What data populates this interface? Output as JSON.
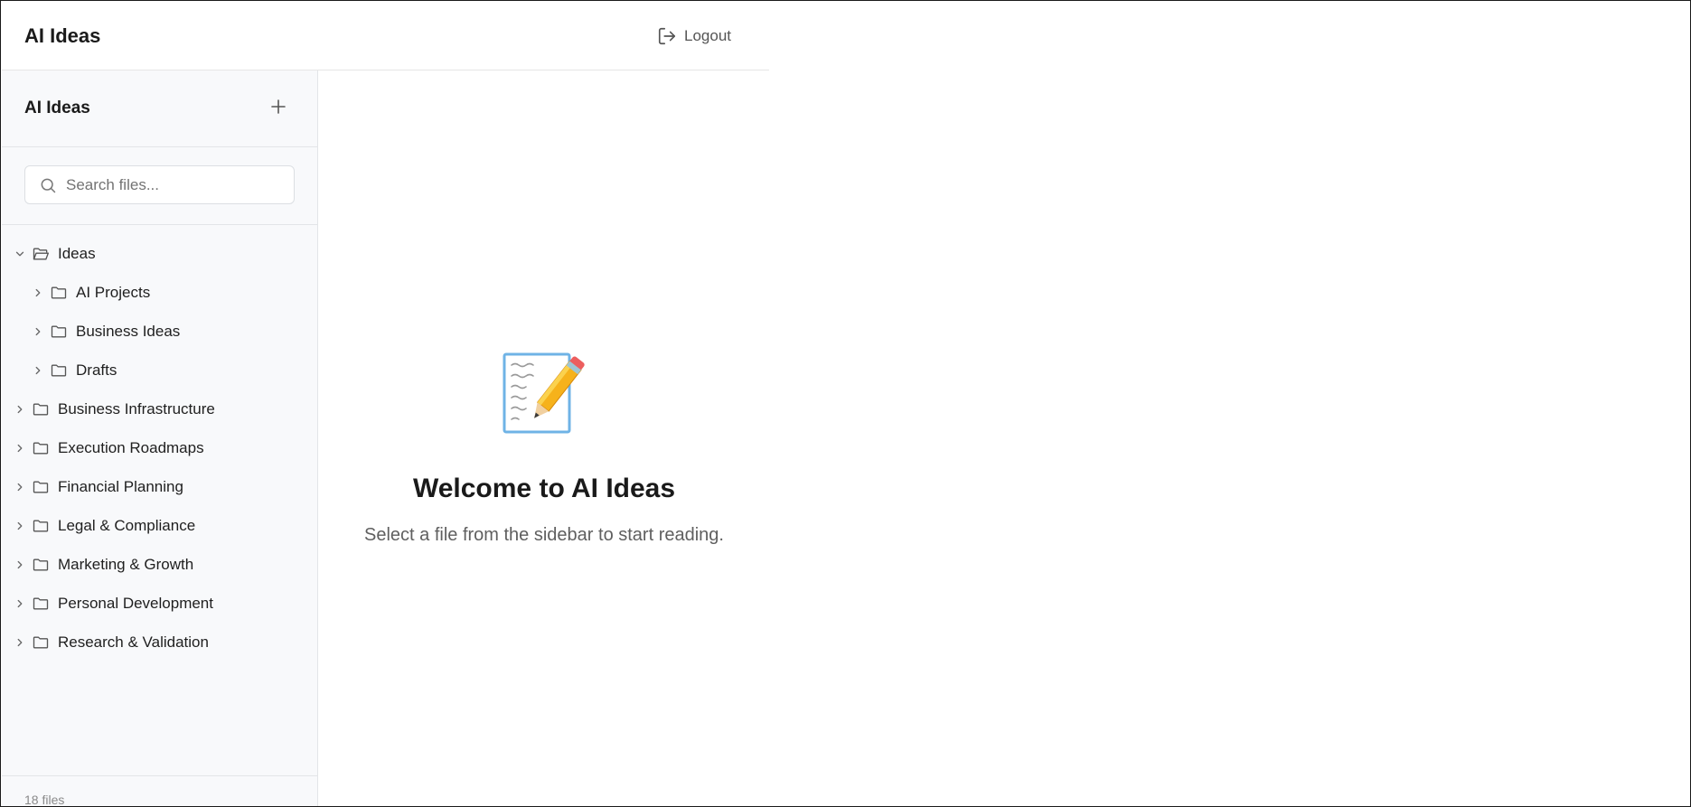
{
  "header": {
    "app_title": "AI Ideas",
    "logout_label": "Logout",
    "logout_icon": "logout-icon"
  },
  "sidebar": {
    "title": "AI Ideas",
    "add_icon": "plus-icon",
    "search": {
      "placeholder": "Search files...",
      "value": "",
      "icon": "search-icon"
    },
    "tree": [
      {
        "label": "Ideas",
        "expanded": true,
        "children": [
          {
            "label": "AI Projects",
            "expanded": false
          },
          {
            "label": "Business Ideas",
            "expanded": false
          },
          {
            "label": "Drafts",
            "expanded": false
          }
        ]
      },
      {
        "label": "Business Infrastructure",
        "expanded": false
      },
      {
        "label": "Execution Roadmaps",
        "expanded": false
      },
      {
        "label": "Financial Planning",
        "expanded": false
      },
      {
        "label": "Legal & Compliance",
        "expanded": false
      },
      {
        "label": "Marketing & Growth",
        "expanded": false
      },
      {
        "label": "Personal Development",
        "expanded": false
      },
      {
        "label": "Research & Validation",
        "expanded": false
      }
    ],
    "footer_count": "18 files"
  },
  "main": {
    "illustration": "memo-pencil-icon",
    "welcome_title": "Welcome to AI Ideas",
    "welcome_subtitle": "Select a file from the sidebar to start reading."
  },
  "colors": {
    "sidebar_bg": "#f8f9fb",
    "border": "#e3e5e8",
    "text_primary": "#1a1a1a",
    "text_muted": "#5f5f5f"
  }
}
